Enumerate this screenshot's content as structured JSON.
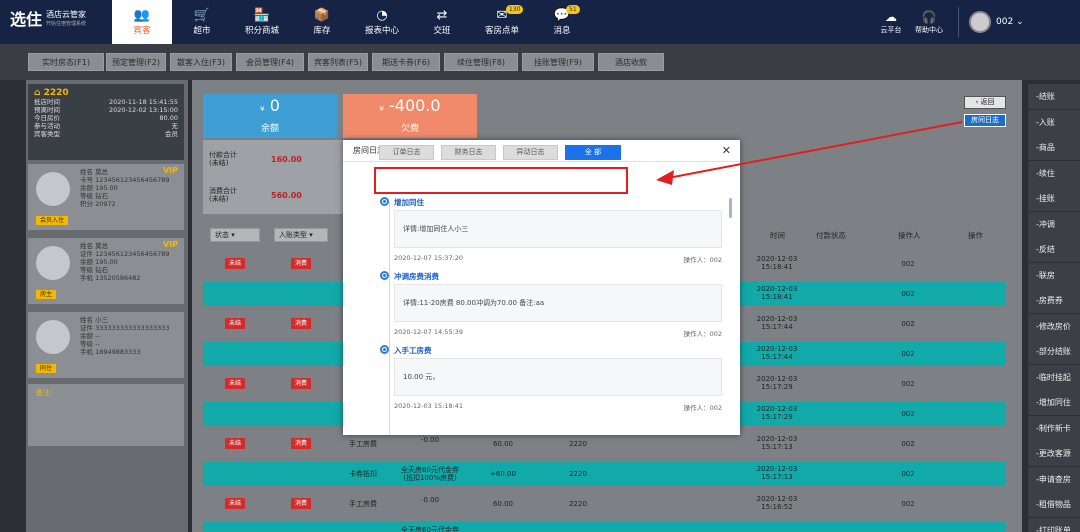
{
  "logo": {
    "brand": "选住",
    "title": "酒店云管家",
    "subtitle": "开始住宿管理系统"
  },
  "nav": [
    {
      "label": "宾客",
      "icon": "guest-icon",
      "glyph": "👥"
    },
    {
      "label": "超市",
      "icon": "cart-icon",
      "glyph": "🛒"
    },
    {
      "label": "积分商城",
      "icon": "shop-icon",
      "glyph": "🏪"
    },
    {
      "label": "库存",
      "icon": "box-icon",
      "glyph": "📦"
    },
    {
      "label": "报表中心",
      "icon": "pie-chart-icon",
      "glyph": "◔"
    },
    {
      "label": "交班",
      "icon": "handover-icon",
      "glyph": "⇄"
    },
    {
      "label": "客房点单",
      "icon": "order-icon",
      "glyph": "✉",
      "badge": "130"
    },
    {
      "label": "消息",
      "icon": "message-icon",
      "glyph": "💬",
      "badge": "51"
    }
  ],
  "topright": {
    "cloud": "云平台",
    "help": "帮助中心",
    "user": "002"
  },
  "tabs": [
    "实时房态(F1)",
    "预定管理(F2)",
    "散客入住(F3)",
    "会员管理(F4)",
    "宾客列表(F5)",
    "期送卡券(F6)",
    "续住管理(F8)",
    "挂账管理(F9)",
    "酒店收款"
  ],
  "room": {
    "number": "2220",
    "rows": [
      {
        "k": "抵店时间",
        "v": "2020-11-18 15:41:55"
      },
      {
        "k": "预离时间",
        "v": "2020-12-02 13:15:00"
      },
      {
        "k": "今日房价",
        "v": "80.00"
      },
      {
        "k": "参与活动",
        "v": "无"
      },
      {
        "k": "宾客类型",
        "v": "会员"
      }
    ]
  },
  "guests": [
    {
      "tag": "会员入住",
      "vip": "VIP",
      "lines": [
        "姓名 莫总",
        "卡号 123456123456456789",
        "余额 195.00",
        "等级 钻石",
        "积分 20972"
      ]
    },
    {
      "tag": "房主",
      "vip": "VIP",
      "lines": [
        "姓名 莫总",
        "证件 123456123456456789",
        "余额 195.00",
        "等级 钻石",
        "手机 13520586482"
      ]
    },
    {
      "tag": "同住",
      "vip": "",
      "lines": [
        "姓名 小三",
        "证件 333333333333333333",
        "余额 --",
        "等级 --",
        "手机 18949883333"
      ]
    }
  ],
  "remark": "备注：",
  "balance": {
    "value": "0",
    "label": "余额",
    "currency": "¥"
  },
  "debt": {
    "value": "-400.0",
    "label": "欠费",
    "currency": "¥"
  },
  "summary": [
    {
      "label": "付款合计",
      "sub": "(未结)",
      "amount": "160.00"
    },
    {
      "label": "消费合计",
      "sub": "(未结)",
      "amount": "560.00"
    }
  ],
  "back_label": "返回",
  "room_log_label": "房间日志",
  "filters": {
    "status": "状态",
    "type": "入账类型"
  },
  "headers": {
    "time": "时间",
    "pay_status": "付款状态",
    "operator": "操作人",
    "action": "操作"
  },
  "rows": [
    {
      "style": "gray",
      "unsettled": "未结",
      "kind": "消费",
      "time": "2020-12-03 15:18:41",
      "op": "002"
    },
    {
      "style": "teal",
      "unsettled": "",
      "kind": "",
      "time": "2020-12-03 15:18:41",
      "op": "002"
    },
    {
      "style": "gray",
      "unsettled": "未结",
      "kind": "消费",
      "time": "2020-12-03 15:17:44",
      "op": "002"
    },
    {
      "style": "teal",
      "unsettled": "",
      "kind": "",
      "time": "2020-12-03 15:17:44",
      "op": "002"
    },
    {
      "style": "gray",
      "unsettled": "未结",
      "kind": "消费",
      "time": "2020-12-03 15:17:29",
      "op": "002"
    },
    {
      "style": "teal",
      "unsettled": "",
      "kind": "",
      "time": "2020-12-03 15:17:29",
      "op": "002"
    },
    {
      "style": "gray",
      "unsettled": "未结",
      "kind": "消费",
      "item": "手工房费",
      "item2": "手工房费",
      "amount": "-0.00",
      "amount2": "60.00",
      "room": "2220",
      "time": "2020-12-03 15:17:13",
      "op": "002"
    },
    {
      "style": "teal",
      "unsettled": "",
      "kind": "",
      "item": "",
      "item2": "卡券抵扣",
      "amount": "全天房60元代金券(抵扣100%房费)",
      "amount2": "+60.00",
      "room": "2220",
      "time": "2020-12-03 15:17:13",
      "op": "002"
    },
    {
      "style": "gray",
      "unsettled": "未结",
      "kind": "消费",
      "item": "手工房费",
      "item2": "手工房费",
      "amount": "-0.00",
      "amount2": "60.00",
      "room": "2220",
      "time": "2020-12-03 15:16:52",
      "op": "002"
    },
    {
      "style": "teal",
      "unsettled": "",
      "kind": "",
      "item": "",
      "item2": "",
      "amount": "全天房60元代金券",
      "amount2": "",
      "room": "",
      "time": "",
      "op": ""
    }
  ],
  "sidebar": [
    "结账",
    "入账",
    "商品",
    "续住",
    "挂账",
    "冲调",
    "反结",
    "联房",
    "房费券",
    "修改房价",
    "部分结账",
    "临时挂起",
    "增加同住",
    "制作新卡",
    "更改客源",
    "申请查房",
    "租借物品",
    "打印账单"
  ],
  "modal": {
    "title": "房间日志",
    "filters": [
      "订单日志",
      "财务日志",
      "异动日志",
      "全 部"
    ],
    "entries": [
      {
        "title": "增加同住",
        "detail": "详情:增加同住人小三",
        "time": "2020-12-07 15:37:20",
        "operator": "操作人：002"
      },
      {
        "title": "冲调房费消费",
        "detail": "详情:11-20房费 80.00冲调为70.00 备注:aa",
        "time": "2020-12-07 14:55:39",
        "operator": "操作人：002"
      },
      {
        "title": "入手工房费",
        "detail": "10.00 元，",
        "time": "2020-12-03 15:18:41",
        "operator": "操作人：002"
      }
    ]
  },
  "colors": {
    "accent": "#1a73e8",
    "teal": "#12a9a9",
    "red": "#d62b2b",
    "orange": "#f05a28",
    "annotation": "#e02020"
  }
}
